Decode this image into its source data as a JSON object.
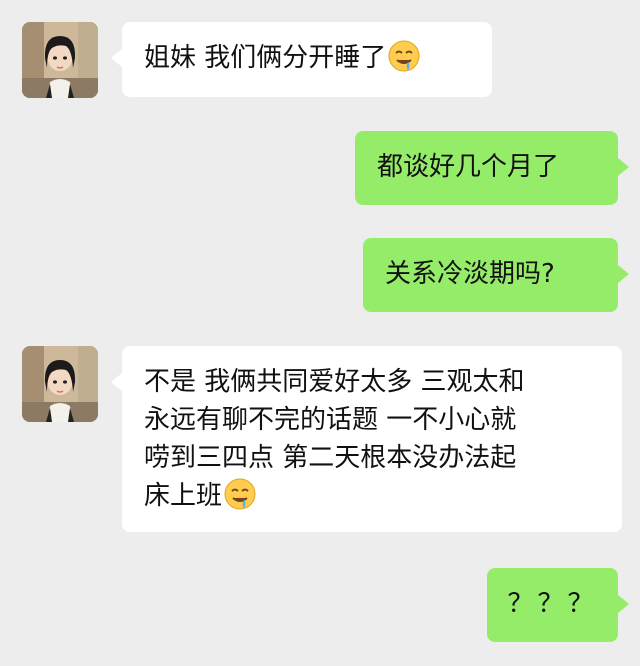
{
  "chat": {
    "messages": [
      {
        "sender": "other",
        "text": "姐妹 我们俩分开睡了",
        "emoji": "drooling-face"
      },
      {
        "sender": "self",
        "text": "都谈好几个月了"
      },
      {
        "sender": "self",
        "text": "关系冷淡期吗?"
      },
      {
        "sender": "other",
        "text": "不是 我俩共同爱好太多 三观太和\n永远有聊不完的话题 一不小心就\n唠到三四点 第二天根本没办法起\n床上班",
        "emoji": "drooling-face"
      },
      {
        "sender": "self",
        "text": "？？？"
      }
    ]
  },
  "colors": {
    "background": "#ededed",
    "incoming_bubble": "#ffffff",
    "outgoing_bubble": "#95ec69"
  }
}
